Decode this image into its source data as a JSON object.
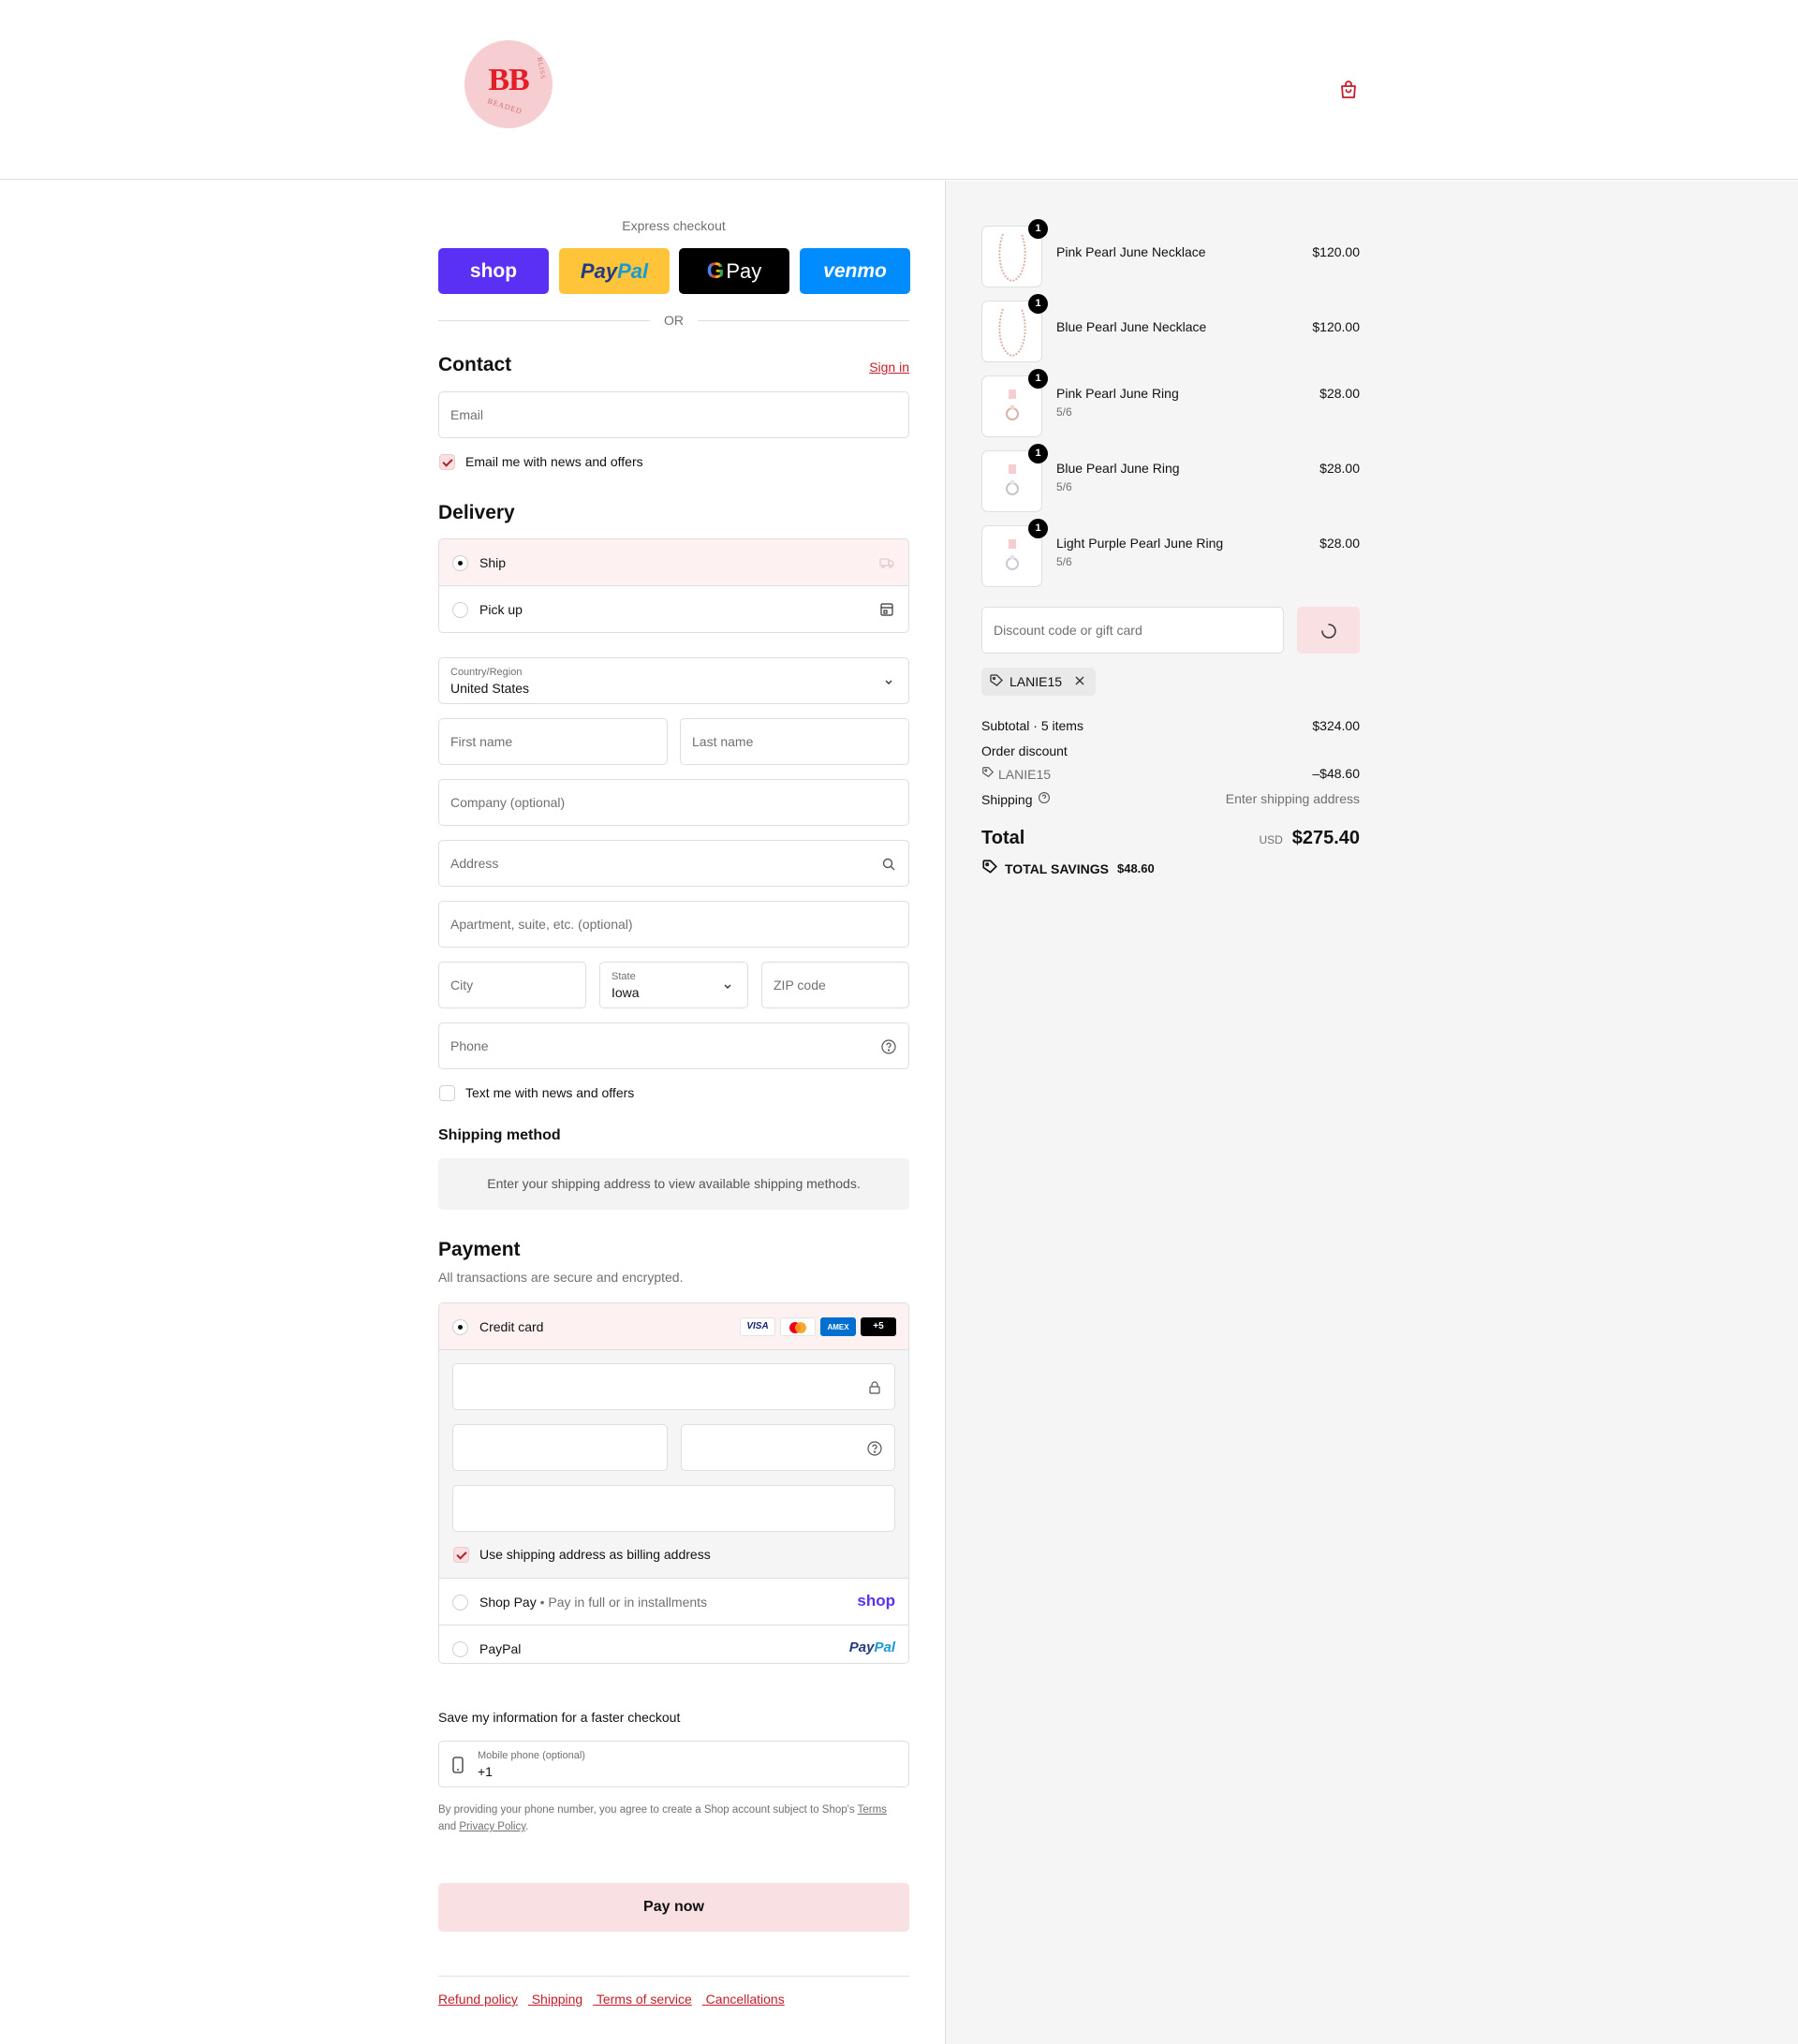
{
  "header": {
    "logo_monogram": "BB",
    "logo_text_a": "BEADED",
    "logo_text_b": "BLISS"
  },
  "express": {
    "label": "Express checkout",
    "shop": "shop",
    "paypal_a": "Pay",
    "paypal_b": "Pal",
    "gpay_g": "G",
    "gpay": "Pay",
    "venmo": "venmo",
    "or": "OR"
  },
  "contact": {
    "title": "Contact",
    "sign_in": "Sign in",
    "email_placeholder": "Email",
    "email_news": "Email me with news and offers"
  },
  "delivery": {
    "title": "Delivery",
    "ship": "Ship",
    "pickup": "Pick up",
    "country_label": "Country/Region",
    "country_value": "United States",
    "first_name": "First name",
    "last_name": "Last name",
    "company": "Company (optional)",
    "address": "Address",
    "apartment": "Apartment, suite, etc. (optional)",
    "city": "City",
    "state_label": "State",
    "state_value": "Iowa",
    "zip": "ZIP code",
    "phone": "Phone",
    "text_news": "Text me with news and offers"
  },
  "shipping_method": {
    "title": "Shipping method",
    "info": "Enter your shipping address to view available shipping methods."
  },
  "payment": {
    "title": "Payment",
    "subtitle": "All transactions are secure and encrypted.",
    "credit_card": "Credit card",
    "visa": "VISA",
    "amex": "AMEX",
    "more": "+5",
    "billing_same": "Use shipping address as billing address",
    "shop_pay": "Shop Pay",
    "shop_pay_sub": "Pay in full or in installments",
    "shop_logo": "shop",
    "paypal": "PayPal",
    "paypal_logo_a": "Pay",
    "paypal_logo_b": "Pal"
  },
  "save_info": {
    "title": "Save my information for a faster checkout",
    "mobile_label": "Mobile phone (optional)",
    "mobile_value": "+1",
    "note_a": "By providing your phone number, you agree to create a Shop account subject to Shop's ",
    "note_terms": "Terms",
    "note_b": "and ",
    "note_privacy": "Privacy Policy",
    "note_c": "."
  },
  "pay_now": "Pay now",
  "footer": {
    "links": [
      "Refund policy",
      "Shipping",
      "Terms of service",
      "Cancellations"
    ]
  },
  "summary": {
    "items": [
      {
        "name": "Pink Pearl June Necklace",
        "variant": "",
        "qty": "1",
        "price": "$120.00"
      },
      {
        "name": "Blue Pearl June Necklace",
        "variant": "",
        "qty": "1",
        "price": "$120.00"
      },
      {
        "name": "Pink Pearl June Ring",
        "variant": "5/6",
        "qty": "1",
        "price": "$28.00"
      },
      {
        "name": "Blue Pearl June Ring",
        "variant": "5/6",
        "qty": "1",
        "price": "$28.00"
      },
      {
        "name": "Light Purple Pearl June Ring",
        "variant": "5/6",
        "qty": "1",
        "price": "$28.00"
      }
    ],
    "discount_placeholder": "Discount code or gift card",
    "applied_code": "LANIE15",
    "subtotal_label": "Subtotal · 5 items",
    "subtotal_value": "$324.00",
    "order_discount_label": "Order discount",
    "discount_code": "LANIE15",
    "discount_value": "–$48.60",
    "shipping_label": "Shipping",
    "shipping_value": "Enter shipping address",
    "total_label": "Total",
    "currency": "USD",
    "total_value": "$275.40",
    "savings_label": "TOTAL SAVINGS",
    "savings_value": "$48.60"
  },
  "colors": {
    "accent": "#c41e2a",
    "pink_bg": "#f9e1e3",
    "shop_purple": "#5a31f4",
    "paypal_yellow": "#ffc439",
    "venmo_blue": "#008cff"
  }
}
